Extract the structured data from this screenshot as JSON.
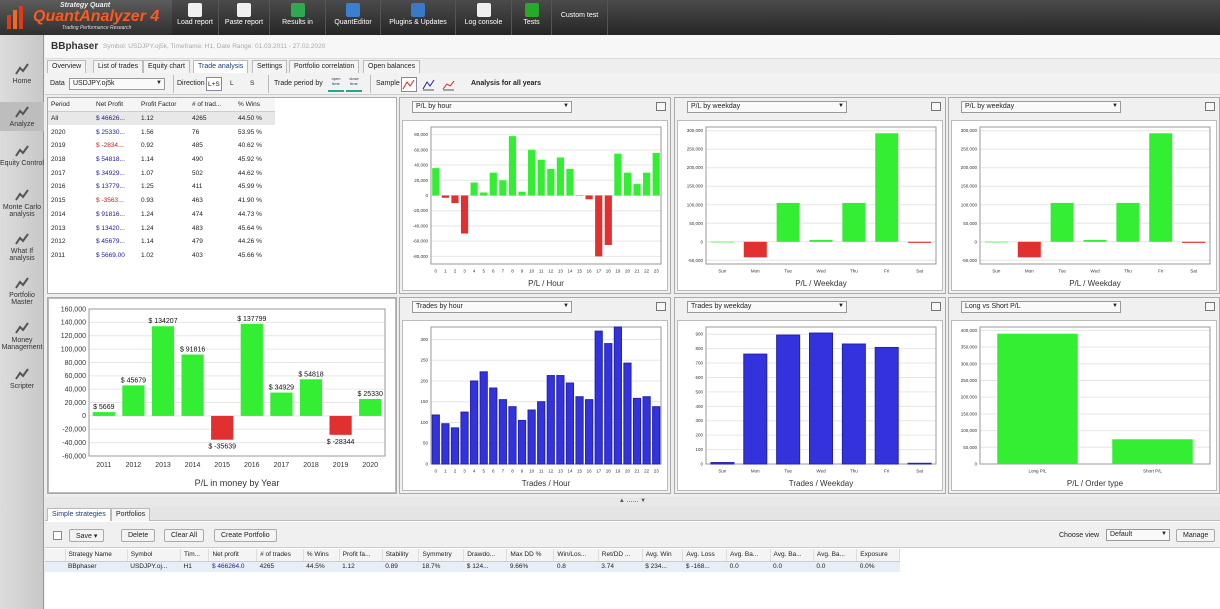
{
  "app": {
    "logo_brand": "Strategy Quant",
    "logo_name": "QuantAnalyzer 4",
    "logo_sub": "Trading Performance   Research"
  },
  "toolbar": [
    {
      "label": "Load report",
      "icon": "load-report-icon"
    },
    {
      "label": "Paste report",
      "icon": "paste-report-icon"
    },
    {
      "label": "Results in",
      "icon": "dollar-icon"
    },
    {
      "label": "QuantEditor",
      "icon": "globe-icon"
    },
    {
      "label": "Plugins & Updates",
      "icon": "puzzle-icon"
    },
    {
      "label": "Log console",
      "icon": "book-icon"
    },
    {
      "label": "Tests",
      "icon": "check-icon"
    },
    {
      "label": "Custom test",
      "icon": ""
    }
  ],
  "sidebar": [
    {
      "label": "Home",
      "icon": "home-icon"
    },
    {
      "label": "Analyze",
      "icon": "analyze-icon"
    },
    {
      "label": "Equity Control",
      "icon": "equity-control-icon"
    },
    {
      "label": "Monte Carlo analysis",
      "icon": "monte-carlo-icon"
    },
    {
      "label": "What If analysis",
      "icon": "what-if-icon"
    },
    {
      "label": "Portfolio Master",
      "icon": "portfolio-icon"
    },
    {
      "label": "Money Management",
      "icon": "money-icon"
    },
    {
      "label": "Scripter",
      "icon": "scripter-icon"
    }
  ],
  "strategy": {
    "name": "BBphaser",
    "meta": "Symbol: USDJPY.oj5k, Timeframe: H1, Date Range: 01.03.2011 - 27.02.2020"
  },
  "tabs": [
    "Overview",
    "List of trades",
    "Equity chart",
    "Trade analysis",
    "Settings",
    "Portfolio correlation",
    "Open balances"
  ],
  "controls": {
    "data_label": "Data",
    "data_value": "USDJPY.oj5k",
    "direction_label": "Direction",
    "dir_options": [
      "L+S",
      "L",
      "S"
    ],
    "trade_period_label": "Trade period by",
    "open_time": "open time",
    "close_time": "close time",
    "sample_label": "Sample",
    "analysis_label": "Analysis for all years"
  },
  "periods": {
    "headers": [
      "Period",
      "Net Profit",
      "Profit Factor",
      "# of trad...",
      "% Wins"
    ],
    "rows": [
      [
        "All",
        "$ 46626...",
        "1.12",
        "4265",
        "44.50 %"
      ],
      [
        "2020",
        "$ 25330...",
        "1.56",
        "76",
        "53.95 %"
      ],
      [
        "2019",
        "$ -2834...",
        "0.92",
        "485",
        "40.62 %"
      ],
      [
        "2018",
        "$ 54818...",
        "1.14",
        "490",
        "45.92 %"
      ],
      [
        "2017",
        "$ 34929...",
        "1.07",
        "502",
        "44.62 %"
      ],
      [
        "2016",
        "$ 13779...",
        "1.25",
        "411",
        "45.99 %"
      ],
      [
        "2015",
        "$ -3563...",
        "0.93",
        "463",
        "41.90 %"
      ],
      [
        "2014",
        "$ 91816...",
        "1.24",
        "474",
        "44.73 %"
      ],
      [
        "2013",
        "$ 13420...",
        "1.24",
        "483",
        "45.64 %"
      ],
      [
        "2012",
        "$ 45679...",
        "1.14",
        "479",
        "44.26 %"
      ],
      [
        "2011",
        "$ 5669.00",
        "1.02",
        "403",
        "45.66 %"
      ]
    ]
  },
  "chart_data": [
    {
      "id": "pl-by-year",
      "type": "bar",
      "selector": "",
      "xlabel": "P/L in money by Year",
      "categories": [
        "2011",
        "2012",
        "2013",
        "2014",
        "2015",
        "2016",
        "2017",
        "2018",
        "2019",
        "2020"
      ],
      "values": [
        5669,
        45679,
        134207,
        91816,
        -35639,
        137799,
        34929,
        54818,
        -28344,
        25330
      ],
      "labels": [
        "$ 5669",
        "$ 45679",
        "$ 134207",
        "$ 91816",
        "$ -35639",
        "$ 137799",
        "$ 34929",
        "$ 54818",
        "$ -28344",
        "$ 25330"
      ],
      "ylim": [
        -60000,
        160000
      ],
      "yticks": [
        "160,000",
        "140,000",
        "120,000",
        "100,000",
        "80,000",
        "60,000",
        "40,000",
        "20,000",
        "0",
        "-20,000",
        "-40,000",
        "-60,000"
      ],
      "pos_color": "#33ee33",
      "neg_color": "#e03030"
    },
    {
      "id": "pl-by-hour",
      "type": "bar",
      "selector": "P/L by hour",
      "xlabel": "P/L / Hour",
      "categories": [
        "0",
        "1",
        "2",
        "3",
        "4",
        "5",
        "6",
        "7",
        "8",
        "9",
        "10",
        "11",
        "12",
        "13",
        "14",
        "15",
        "16",
        "17",
        "18",
        "19",
        "20",
        "21",
        "22",
        "23"
      ],
      "values": [
        36000,
        -3000,
        -10000,
        -50000,
        17000,
        4000,
        30000,
        20000,
        78000,
        5000,
        60000,
        47000,
        35000,
        50000,
        35000,
        0,
        -5000,
        -80000,
        -65000,
        55000,
        30000,
        15000,
        30000,
        56000
      ],
      "ylim": [
        -90000,
        90000
      ],
      "yticks": [
        "80,000",
        "60,000",
        "40,000",
        "20,000",
        "0",
        "-20,000",
        "-40,000",
        "-60,000",
        "-80,000"
      ],
      "pos_color": "#33ee33",
      "neg_color": "#e03030"
    },
    {
      "id": "pl-by-weekday",
      "type": "bar",
      "selector": "P/L by weekday",
      "xlabel": "P/L / Weekday",
      "categories": [
        "Sun",
        "Mon",
        "Tue",
        "Wed",
        "Thu",
        "Fri",
        "Sat"
      ],
      "values": [
        0,
        -42000,
        105000,
        5000,
        105000,
        293000,
        -3000
      ],
      "ylim": [
        -60000,
        310000
      ],
      "yticks": [
        "300,000",
        "250,000",
        "200,000",
        "150,000",
        "100,000",
        "50,000",
        "0",
        "-50,000"
      ],
      "pos_color": "#33ee33",
      "neg_color": "#e03030"
    },
    {
      "id": "pl-by-weekday-2",
      "type": "bar",
      "selector": "P/L by weekday",
      "xlabel": "P/L / Weekday",
      "categories": [
        "Sun",
        "Mon",
        "Tue",
        "Wed",
        "Thu",
        "Fri",
        "Sat"
      ],
      "values": [
        0,
        -42000,
        105000,
        5000,
        105000,
        293000,
        -3000
      ],
      "ylim": [
        -60000,
        310000
      ],
      "yticks": [
        "300,000",
        "250,000",
        "200,000",
        "150,000",
        "100,000",
        "50,000",
        "0",
        "-50,000"
      ],
      "pos_color": "#33ee33",
      "neg_color": "#e03030"
    },
    {
      "id": "trades-by-hour",
      "type": "bar",
      "selector": "Trades by hour",
      "xlabel": "Trades / Hour",
      "categories": [
        "0",
        "1",
        "2",
        "3",
        "4",
        "5",
        "6",
        "7",
        "8",
        "9",
        "10",
        "11",
        "12",
        "13",
        "14",
        "15",
        "16",
        "17",
        "18",
        "19",
        "20",
        "21",
        "22",
        "23"
      ],
      "values": [
        118,
        97,
        87,
        125,
        200,
        222,
        183,
        155,
        138,
        105,
        130,
        150,
        213,
        213,
        195,
        162,
        155,
        320,
        290,
        330,
        243,
        158,
        162,
        138
      ],
      "ylim": [
        0,
        330
      ],
      "yticks": [
        "300",
        "250",
        "200",
        "150",
        "100",
        "50",
        "0"
      ],
      "color": "#3333dd"
    },
    {
      "id": "trades-by-weekday",
      "type": "bar",
      "selector": "Trades by weekday",
      "xlabel": "Trades / Weekday",
      "categories": [
        "Sun",
        "Mon",
        "Tue",
        "Wed",
        "Thu",
        "Fri",
        "Sat"
      ],
      "values": [
        10,
        762,
        894,
        908,
        832,
        808,
        5
      ],
      "ylim": [
        0,
        950
      ],
      "yticks": [
        "900",
        "800",
        "700",
        "600",
        "500",
        "400",
        "300",
        "200",
        "100",
        "0"
      ],
      "color": "#3333dd"
    },
    {
      "id": "long-vs-short",
      "type": "bar",
      "selector": "Long vs Short P/L",
      "xlabel": "P/L / Order type",
      "categories": [
        "Long P/L",
        "Short P/L"
      ],
      "values": [
        390000,
        74000
      ],
      "ylim": [
        0,
        410000
      ],
      "yticks": [
        "400,000",
        "350,000",
        "300,000",
        "250,000",
        "200,000",
        "150,000",
        "100,000",
        "50,000",
        "0"
      ],
      "pos_color": "#33ee33"
    }
  ],
  "bottom": {
    "tabs": [
      "Simple strategies",
      "Portfolios"
    ],
    "buttons": {
      "save": "Save",
      "delete": "Delete",
      "clear": "Clear All",
      "create": "Create Portfolio",
      "manage": "Manage"
    },
    "choose_view": "Choose view",
    "view_value": "Default",
    "headers": [
      "Strategy Name",
      "Symbol",
      "Tim...",
      "Net profit",
      "# of trades",
      "% Wins",
      "Profit fa...",
      "Stability",
      "Symmetry",
      "Drawdo...",
      "Max DD %",
      "Win/Los...",
      "Ret/DD ...",
      "Avg. Win",
      "Avg. Loss",
      "Avg. Ba...",
      "Avg. Ba...",
      "Avg. Ba...",
      "Exposure"
    ],
    "row": [
      "BBphaser",
      "USDJPY.oj...",
      "H1",
      "$ 466264.0",
      "4265",
      "44.5%",
      "1.12",
      "0.89",
      "18.7%",
      "$ 124...",
      "9.66%",
      "0.8",
      "3.74",
      "$ 234...",
      "$ -168...",
      "0.0",
      "0.0",
      "0.0",
      "0.0%"
    ]
  }
}
